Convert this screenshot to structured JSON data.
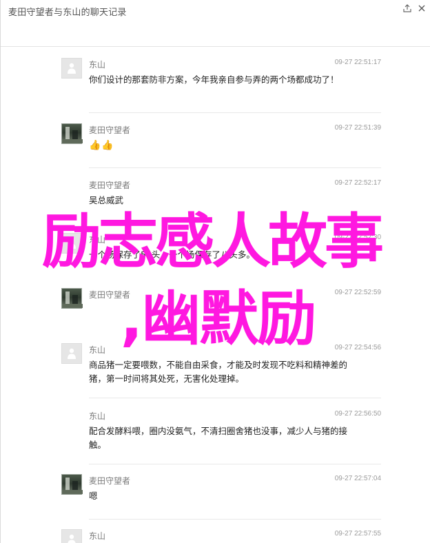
{
  "window": {
    "title": "麦田守望者与东山的聊天记录",
    "share_icon": "share-icon",
    "close_icon": "close-icon"
  },
  "messages": [
    {
      "sender": "东山",
      "avatar": "default-avatar",
      "time": "09-27 22:51:17",
      "text": "你们设计的那套防非方案，今年我亲自参与弄的两个场都成功了！"
    },
    {
      "sender": "麦田守望者",
      "avatar": "photo-avatar",
      "time": "09-27 22:51:39",
      "text": "👍👍"
    },
    {
      "sender": "麦田守望者",
      "avatar": "photo-avatar",
      "time": "09-27 22:52:17",
      "text": "吴总威武"
    },
    {
      "sender": "东山",
      "avatar": "default-avatar",
      "time": "09-27 22:52:30",
      "text": "一个场保存了55头，一个场保存了八头多。"
    },
    {
      "sender": "麦田守望者",
      "avatar": "photo-avatar",
      "time": "09-27 22:52:59",
      "text": ""
    },
    {
      "sender": "东山",
      "avatar": "default-avatar",
      "time": "09-27 22:54:56",
      "text": "商品猪一定要喂数，不能自由采食，才能及时发现不吃料和精神差的猪，第一时间将其处死，无害化处理掉。"
    },
    {
      "sender": "东山",
      "avatar": "default-avatar",
      "time": "09-27 22:56:50",
      "text": "配合发酵料喂，圈内没氨气，不清扫圈舍猪也没事，减少人与猪的接触。"
    },
    {
      "sender": "麦田守望者",
      "avatar": "photo-avatar",
      "time": "09-27 22:57:04",
      "text": "嗯"
    },
    {
      "sender": "东山",
      "avatar": "default-avatar",
      "time": "09-27 22:57:55",
      "text": ""
    }
  ],
  "overlay": {
    "line1": "励志感人故事",
    "line2": ",幽默励"
  },
  "colors": {
    "overlay": "#ff18e0",
    "name": "#7a7a7a",
    "time": "#9a9a9a",
    "separator": "#e8e8e8"
  }
}
